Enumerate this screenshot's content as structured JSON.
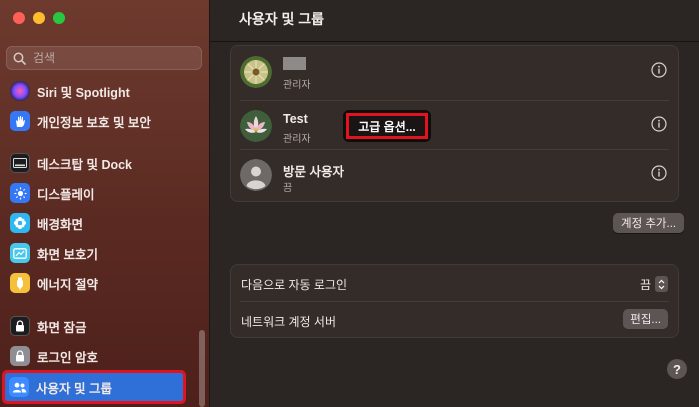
{
  "window": {
    "title": "사용자 및 그룹"
  },
  "sidebar": {
    "search_placeholder": "검색",
    "items": [
      {
        "label": "Siri 및 Spotlight",
        "icon": "siri-icon"
      },
      {
        "label": "개인정보 보호 및 보안",
        "icon": "hand-icon"
      },
      {
        "label": "데스크탑 및 Dock",
        "icon": "dock-icon"
      },
      {
        "label": "디스플레이",
        "icon": "display-icon"
      },
      {
        "label": "배경화면",
        "icon": "wallpaper-icon"
      },
      {
        "label": "화면 보호기",
        "icon": "screensaver-icon"
      },
      {
        "label": "에너지 절약",
        "icon": "energy-icon"
      },
      {
        "label": "화면 잠금",
        "icon": "lock-screen-icon"
      },
      {
        "label": "로그인 암호",
        "icon": "padlock-icon"
      },
      {
        "label": "사용자 및 그룹",
        "icon": "users-icon",
        "selected": true
      }
    ]
  },
  "users": [
    {
      "name": "",
      "role": "관리자",
      "avatar": "dandelion-avatar",
      "redacted": true
    },
    {
      "name": "Test",
      "role": "관리자",
      "avatar": "lotus-avatar"
    },
    {
      "name": "방문 사용자",
      "role": "끔",
      "avatar": "guest-avatar"
    }
  ],
  "buttons": {
    "advanced_options": "고급 옵션...",
    "add_account": "계정 추가...",
    "edit": "편집...",
    "help": "?"
  },
  "settings": {
    "auto_login_label": "다음으로 자동 로그인",
    "auto_login_value": "끔",
    "network_server_label": "네트워크 계정 서버"
  },
  "colors": {
    "accent": "#2e6fd8",
    "highlight": "#e0141e"
  }
}
